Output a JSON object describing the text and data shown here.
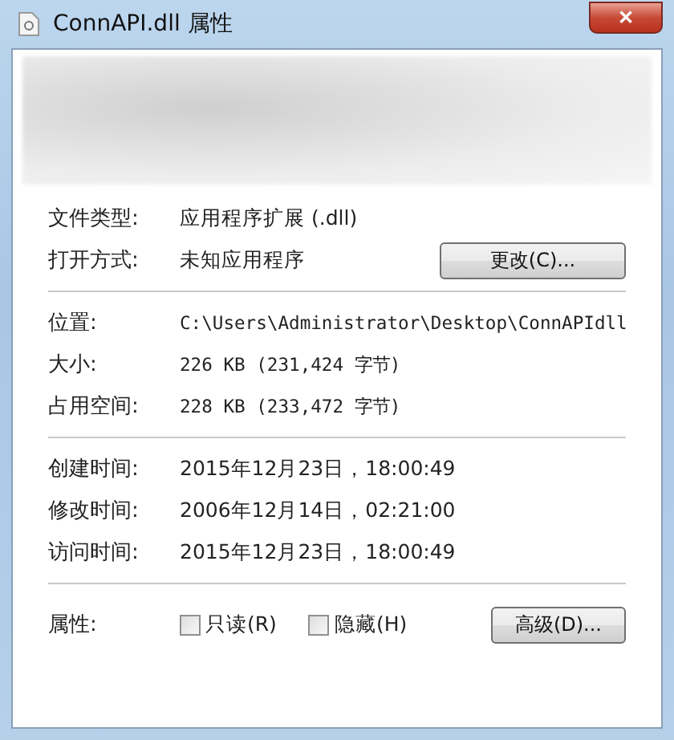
{
  "window": {
    "title": "ConnAPI.dll 属性",
    "close": "✕"
  },
  "rows": [
    {
      "kind": "text",
      "label": "文件类型:",
      "value": "应用程序扩展 (.dll)"
    },
    {
      "kind": "button",
      "label": "打开方式:",
      "value": "未知应用程序",
      "button": "更改(C)..."
    },
    {
      "kind": "divider"
    },
    {
      "kind": "mono",
      "label": "位置:",
      "value": "C:\\Users\\Administrator\\Desktop\\ConnAPIdll"
    },
    {
      "kind": "mono",
      "label": "大小:",
      "value": "226 KB (231,424 字节)"
    },
    {
      "kind": "mono",
      "label": "占用空间:",
      "value": "228 KB (233,472 字节)"
    },
    {
      "kind": "divider"
    },
    {
      "kind": "text",
      "label": "创建时间:",
      "value": "2015年12月23日，18:00:49"
    },
    {
      "kind": "text",
      "label": "修改时间:",
      "value": "2006年12月14日，02:21:00"
    },
    {
      "kind": "text",
      "label": "访问时间:",
      "value": "2015年12月23日，18:00:49"
    },
    {
      "kind": "divider"
    }
  ],
  "attributes": {
    "label": "属性:",
    "checkboxes": [
      {
        "label": "只读(R)",
        "checked": false
      },
      {
        "label": "隐藏(H)",
        "checked": false
      }
    ],
    "button": "高级(D)..."
  }
}
